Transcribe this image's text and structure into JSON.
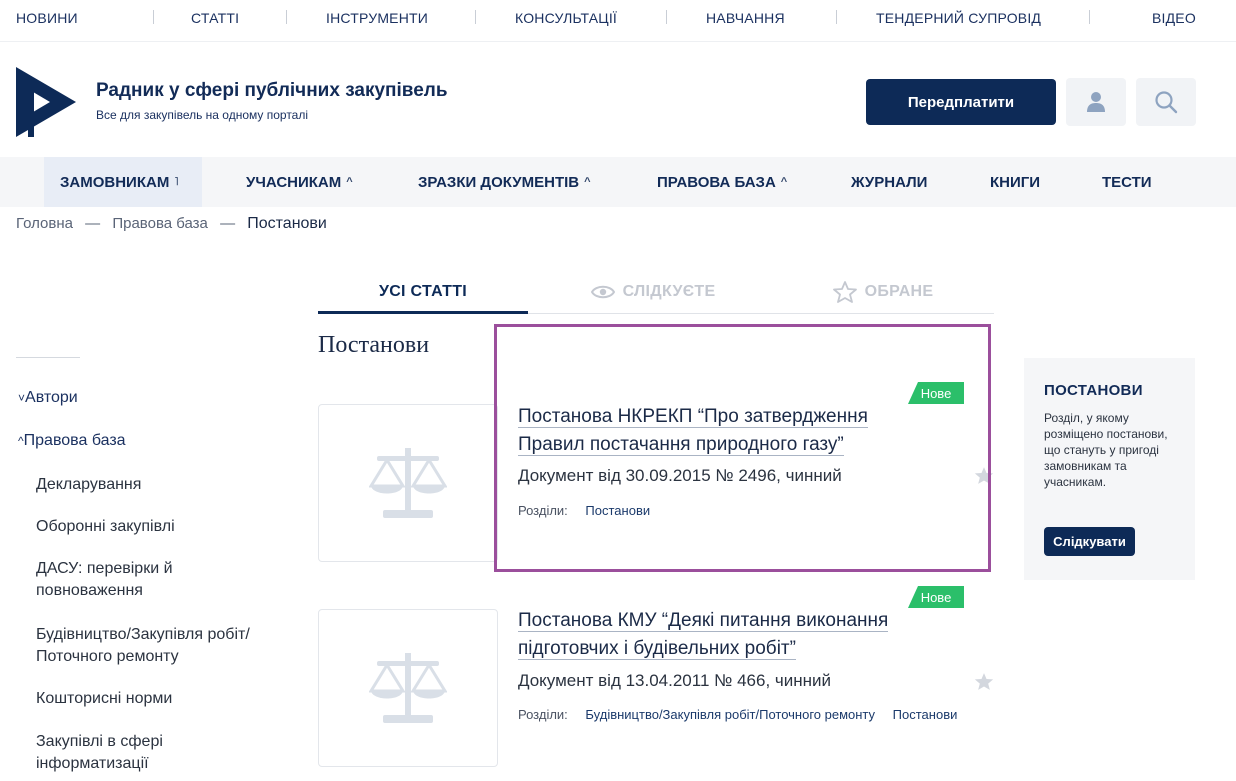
{
  "top_nav": [
    "НОВИНИ",
    "СТАТТІ",
    "ІНСТРУМЕНТИ",
    "КОНСУЛЬТАЦІЇ",
    "НАВЧАННЯ",
    "ТЕНДЕРНИЙ СУПРОВІД",
    "ВІДЕО"
  ],
  "header": {
    "title": "Радник у сфері публічних закупівель",
    "subtitle": "Все для закупівель на одному порталі",
    "subscribe_label": "Передплатити",
    "user_icon": "user-icon",
    "search_icon": "search-icon"
  },
  "main_nav": [
    {
      "label": "ЗАМОВНИКАМ",
      "caret": "˥"
    },
    {
      "label": "УЧАСНИКАМ",
      "caret": "^"
    },
    {
      "label": "ЗРАЗКИ ДОКУМЕНТІВ",
      "caret": "^"
    },
    {
      "label": "ПРАВОВА БАЗА",
      "caret": "^"
    },
    {
      "label": "ЖУРНАЛИ",
      "caret": ""
    },
    {
      "label": "КНИГИ",
      "caret": ""
    },
    {
      "label": "ТЕСТИ",
      "caret": ""
    }
  ],
  "breadcrumbs": {
    "items": [
      "Головна",
      "Правова база",
      "Постанови"
    ],
    "separator": "—"
  },
  "sidebar": {
    "groups": [
      {
        "label": "Автори",
        "toggle": "˅"
      },
      {
        "label": "Правова база",
        "toggle": "^"
      }
    ],
    "items": [
      "Декларування",
      "Оборонні закупівлі",
      "ДАСУ: перевірки й повноваження",
      "Будівництво/Закупівля робіт/ Поточного ремонту",
      "Кошторисні норми",
      "Закупівлі в сфері інформатизації"
    ]
  },
  "tabs": [
    {
      "label": "УСІ СТАТТІ",
      "icon": ""
    },
    {
      "label": "СЛІДКУЄТЕ",
      "icon": "eye-icon"
    },
    {
      "label": "ОБРАНЕ",
      "icon": "star-icon"
    }
  ],
  "section_title": "Постанови",
  "articles": [
    {
      "badge": "Нове",
      "title_lines": [
        "Постанова НКРЕКП “Про затвердження",
        "Правил постачання природного газу”"
      ],
      "meta": "Документ від 30.09.2015 № 2496, чинний",
      "sections_label": "Розділи:",
      "sections": [
        "Постанови"
      ],
      "thumb_icon": "scales-icon"
    },
    {
      "badge": "Нове",
      "title_lines": [
        "Постанова КМУ “Деякі питання виконання",
        "підготовчих і будівельних робіт”"
      ],
      "meta": "Документ від 13.04.2011 № 466, чинний",
      "sections_label": "Розділи:",
      "sections": [
        "Будівництво/Закупівля робіт/Поточного ремонту",
        "Постанови"
      ],
      "thumb_icon": "scales-icon"
    }
  ],
  "right_box": {
    "title": "ПОСТАНОВИ",
    "description": "Розділ, у якому розміщено постанови, що стануть у пригоді замовникам та учасникам.",
    "follow_label": "Слідкувати"
  },
  "colors": {
    "brand": "#0d2a57",
    "badge": "#2bbf6a",
    "highlight": "#9b4f9c"
  }
}
